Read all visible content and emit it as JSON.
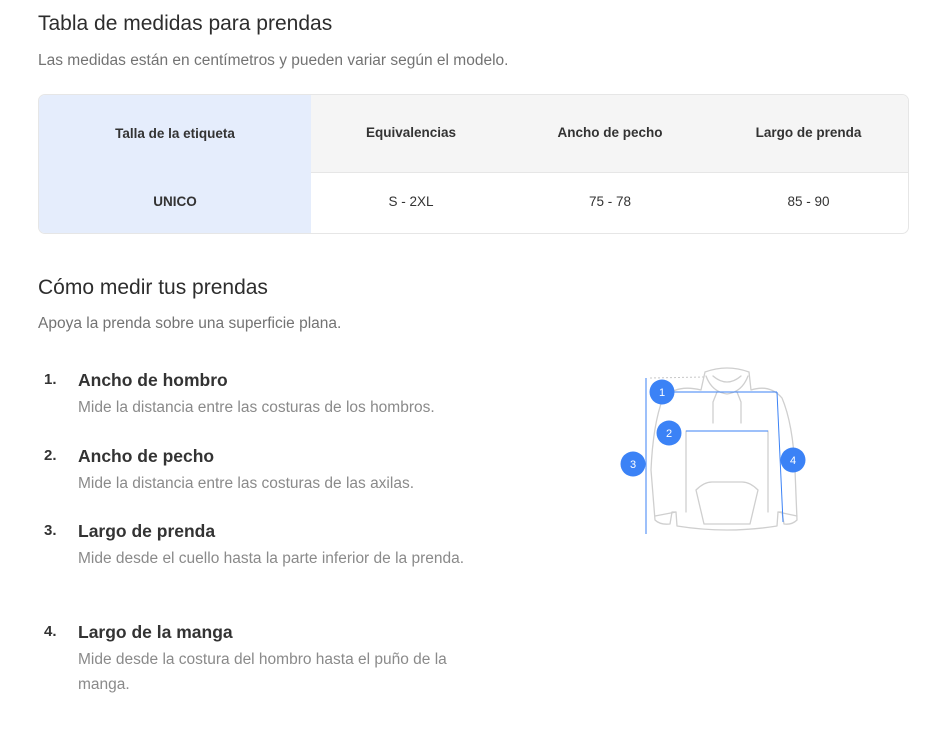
{
  "heading": "Tabla de medidas para prendas",
  "subheading": "Las medidas están en centímetros y pueden variar según el modelo.",
  "table": {
    "headers": [
      "Talla de la etiqueta",
      "Equivalencias",
      "Ancho de pecho",
      "Largo de prenda"
    ],
    "rows": [
      [
        "UNICO",
        "S - 2XL",
        "75 - 78",
        "85 - 90"
      ]
    ],
    "highlight_color": "#e5edfc"
  },
  "how_to": {
    "title": "Cómo medir tus prendas",
    "subtitle": "Apoya la prenda sobre una superficie plana.",
    "steps": [
      {
        "num": "1.",
        "title": "Ancho de hombro",
        "desc": "Mide la distancia entre las costuras de los hombros."
      },
      {
        "num": "2.",
        "title": "Ancho de pecho",
        "desc": "Mide la distancia entre las costuras de las axilas."
      },
      {
        "num": "3.",
        "title": "Largo de prenda",
        "desc": "Mide desde el cuello hasta la parte inferior de la prenda."
      },
      {
        "num": "4.",
        "title": "Largo de la manga",
        "desc": "Mide desde la costura del hombro hasta el puño de la manga."
      }
    ]
  },
  "diagram": {
    "icon": "hoodie-measurement-diagram",
    "markers": [
      "1",
      "2",
      "3",
      "4"
    ],
    "accent_color": "#3b82f6"
  }
}
